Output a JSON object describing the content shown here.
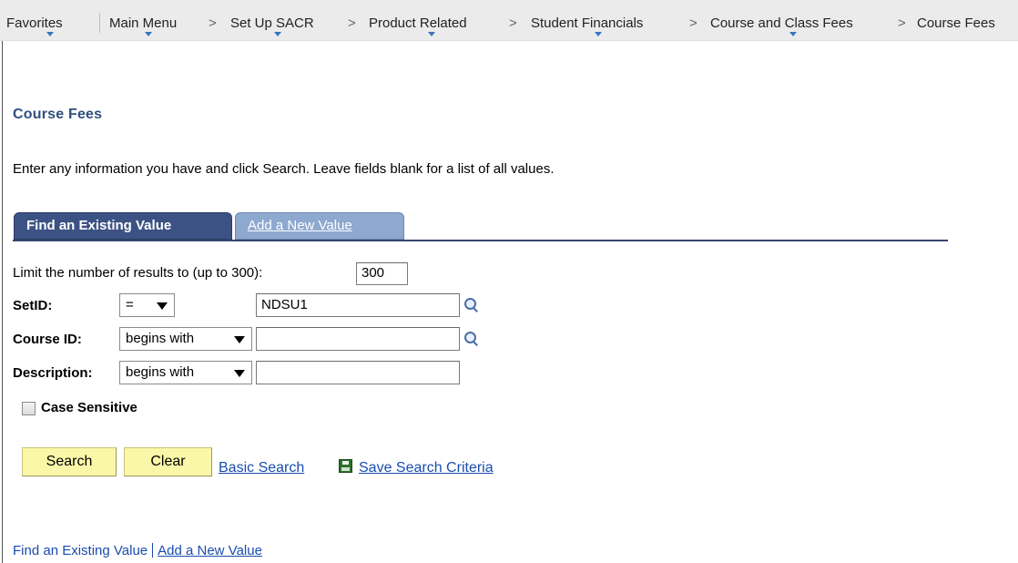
{
  "breadcrumb": {
    "items": [
      {
        "label": "Favorites",
        "dropdown": true
      },
      {
        "label": "Main Menu",
        "dropdown": true
      },
      {
        "label": "Set Up SACR",
        "dropdown": true
      },
      {
        "label": "Product Related",
        "dropdown": true
      },
      {
        "label": "Student Financials",
        "dropdown": true
      },
      {
        "label": "Course and Class Fees",
        "dropdown": true
      },
      {
        "label": "Course Fees",
        "dropdown": false
      }
    ],
    "separator": ">"
  },
  "page": {
    "title": "Course Fees",
    "instructions": "Enter any information you have and click Search. Leave fields blank for a list of all values."
  },
  "tabs": {
    "active": "Find an Existing Value",
    "inactive": "Add a New Value"
  },
  "form": {
    "limit_label": "Limit the number of results to (up to 300):",
    "limit_value": "300",
    "setid": {
      "label": "SetID:",
      "operator": "=",
      "value": "NDSU1"
    },
    "course_id": {
      "label": "Course ID:",
      "operator": "begins with",
      "value": ""
    },
    "description": {
      "label": "Description:",
      "operator": "begins with",
      "value": ""
    },
    "case_sensitive_label": "Case Sensitive",
    "case_sensitive_checked": false
  },
  "buttons": {
    "search": "Search",
    "clear": "Clear",
    "basic_search": "Basic Search",
    "save_search": "Save Search Criteria"
  },
  "footer": {
    "find_existing": "Find an Existing Value",
    "add_new": "Add a New Value"
  },
  "colors": {
    "title": "#2f4f7f",
    "tab_active": "#3d5284",
    "tab_inactive": "#8ea9cf",
    "button_bg": "#fbf7a8",
    "link": "#1a4cae",
    "breadcrumb_bg": "#ebebeb"
  },
  "icons": [
    "lookup-icon",
    "save-icon",
    "dropdown-caret-icon"
  ]
}
